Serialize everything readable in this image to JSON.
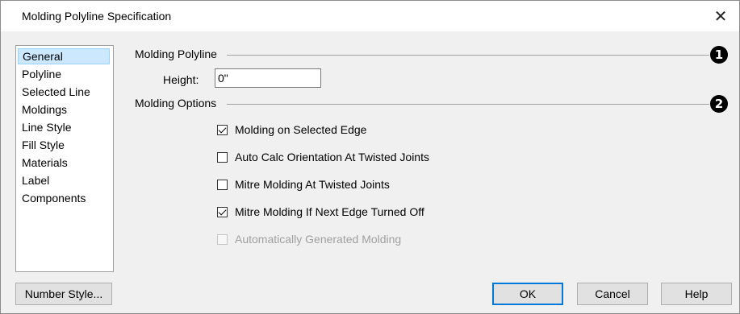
{
  "window": {
    "title": "Molding Polyline Specification",
    "close_glyph": "✕"
  },
  "nav": {
    "items": [
      {
        "label": "General",
        "selected": true
      },
      {
        "label": "Polyline"
      },
      {
        "label": "Selected Line"
      },
      {
        "label": "Moldings"
      },
      {
        "label": "Line Style"
      },
      {
        "label": "Fill Style"
      },
      {
        "label": "Materials"
      },
      {
        "label": "Label"
      },
      {
        "label": "Components"
      }
    ]
  },
  "molding_polyline": {
    "heading": "Molding Polyline",
    "badge": "1",
    "height_label": "Height:",
    "height_value": "0\""
  },
  "molding_options": {
    "heading": "Molding Options",
    "badge": "2",
    "checkboxes": [
      {
        "label": "Molding on Selected Edge",
        "checked": true,
        "enabled": true
      },
      {
        "label": "Auto Calc Orientation At Twisted Joints",
        "checked": false,
        "enabled": true
      },
      {
        "label": "Mitre Molding At Twisted Joints",
        "checked": false,
        "enabled": true
      },
      {
        "label": "Mitre Molding If Next Edge Turned Off",
        "checked": true,
        "enabled": true
      },
      {
        "label": "Automatically Generated Molding",
        "checked": false,
        "enabled": false
      }
    ]
  },
  "buttons": {
    "number_style": "Number Style...",
    "ok": "OK",
    "cancel": "Cancel",
    "help": "Help"
  },
  "colors": {
    "accent": "#0078d7",
    "selection": "#cce8ff",
    "background": "#f0f0f0"
  }
}
